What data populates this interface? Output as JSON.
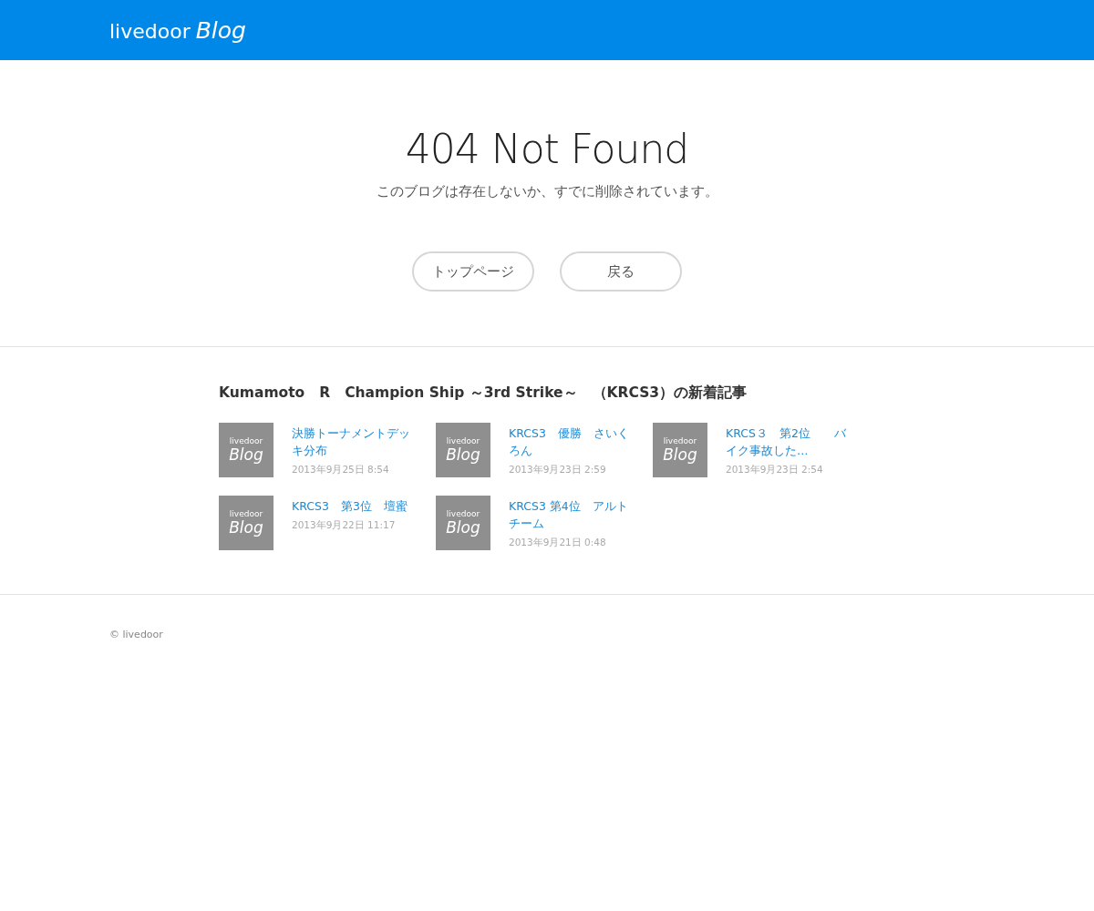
{
  "header": {
    "logo": {
      "brand": "livedoor",
      "product": "Blog"
    }
  },
  "error": {
    "title": "404 Not Found",
    "message": "このブログは存在しないか、すでに削除されています。"
  },
  "buttons": [
    "トップページ",
    "戻る"
  ],
  "recent": {
    "heading": "Kumamoto　R　Champion Ship ～3rd Strike～　（KRCS3）の新着記事",
    "articles": [
      {
        "thumbnail": {
          "brand": "livedoor",
          "product": "Blog"
        },
        "title": "決勝トーナメントデッキ分布",
        "date": "2013年9月25日 8:54"
      },
      {
        "thumbnail": {
          "brand": "livedoor",
          "product": "Blog"
        },
        "title": "KRCS3　優勝　さいくろん",
        "date": "2013年9月23日 2:59"
      },
      {
        "thumbnail": {
          "brand": "livedoor",
          "product": "Blog"
        },
        "title": "KRCS３　第2位　　バイク事故した…",
        "date": "2013年9月23日 2:54"
      },
      {
        "thumbnail": {
          "brand": "livedoor",
          "product": "Blog"
        },
        "title": "KRCS3　第3位　壇蜜",
        "date": "2013年9月22日 11:17"
      },
      {
        "thumbnail": {
          "brand": "livedoor",
          "product": "Blog"
        },
        "title": "KRCS3 第4位　アルトチーム",
        "date": "2013年9月21日 0:48"
      }
    ]
  },
  "footer": {
    "copyright": "© livedoor"
  }
}
